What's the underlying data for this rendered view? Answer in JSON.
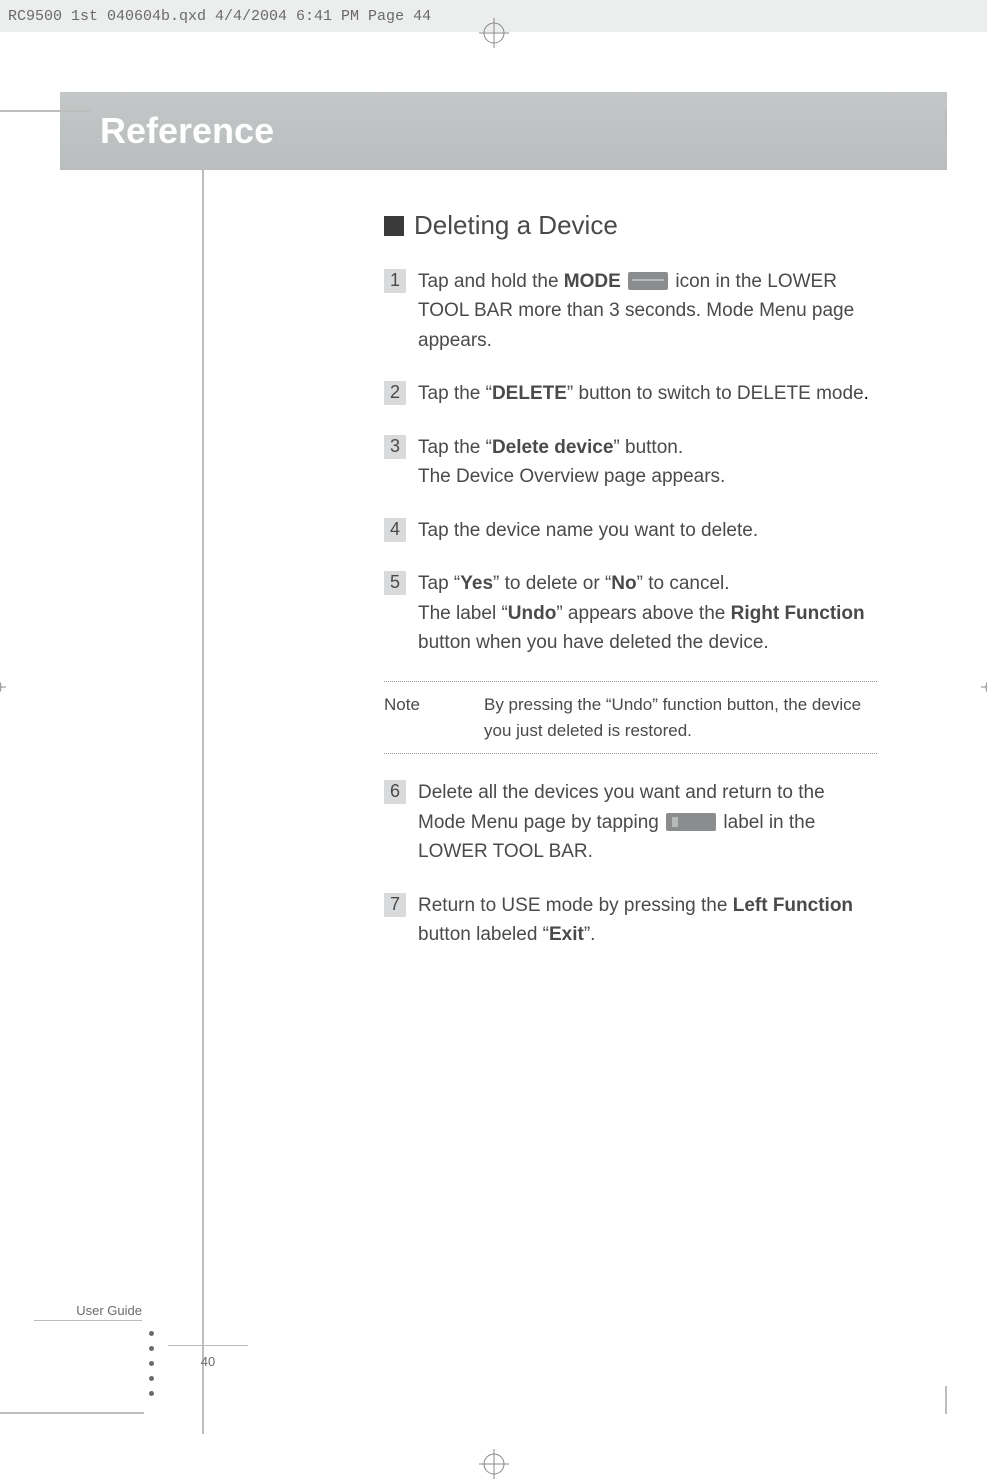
{
  "meta": {
    "headerLine": "RC9500 1st 040604b.qxd  4/4/2004  6:41 PM  Page 44"
  },
  "title": "Reference",
  "section": {
    "heading": "Deleting a Device",
    "steps": [
      {
        "n": "1",
        "pre": "Tap and hold the ",
        "bold1": "MODE",
        "mid": " icon in the LOWER TOOL BAR more than 3 seconds. Mode Menu page appears.",
        "icon": "mode"
      },
      {
        "n": "2",
        "pre": "Tap the “",
        "bold1": "DELETE",
        "mid": "” button to switch to DELETE mode",
        "tail": "."
      },
      {
        "n": "3",
        "pre": "Tap the “",
        "bold1": "Delete device",
        "mid": "” button.",
        "line2": "The Device Overview page appears."
      },
      {
        "n": "4",
        "pre": "Tap the device name you want to delete."
      },
      {
        "n": "5",
        "pre": "Tap “",
        "bold1": "Yes",
        "mid": "” to delete or “",
        "bold2": "No",
        "mid2": "” to cancel.",
        "line2_pre": "The label “",
        "line2_b1": "Undo",
        "line2_mid": "” appears above the ",
        "line2_b2": "Right Function",
        "line2_tail": " button when you have deleted the device."
      },
      {
        "n": "6",
        "pre": "Delete all the devices you want and return to the Mode Menu page by tapping ",
        "icon": "delete",
        "mid": " label in the LOWER TOOL BAR."
      },
      {
        "n": "7",
        "pre": "Return to USE mode by pressing the ",
        "bold1": "Left Function",
        "mid": " button labeled “",
        "bold2": "Exit",
        "mid2": "”."
      }
    ],
    "note": {
      "label": "Note",
      "text": "By pressing the “Undo” function button, the device you just deleted is restored."
    }
  },
  "footer": {
    "guide": "User Guide",
    "page": "40"
  }
}
